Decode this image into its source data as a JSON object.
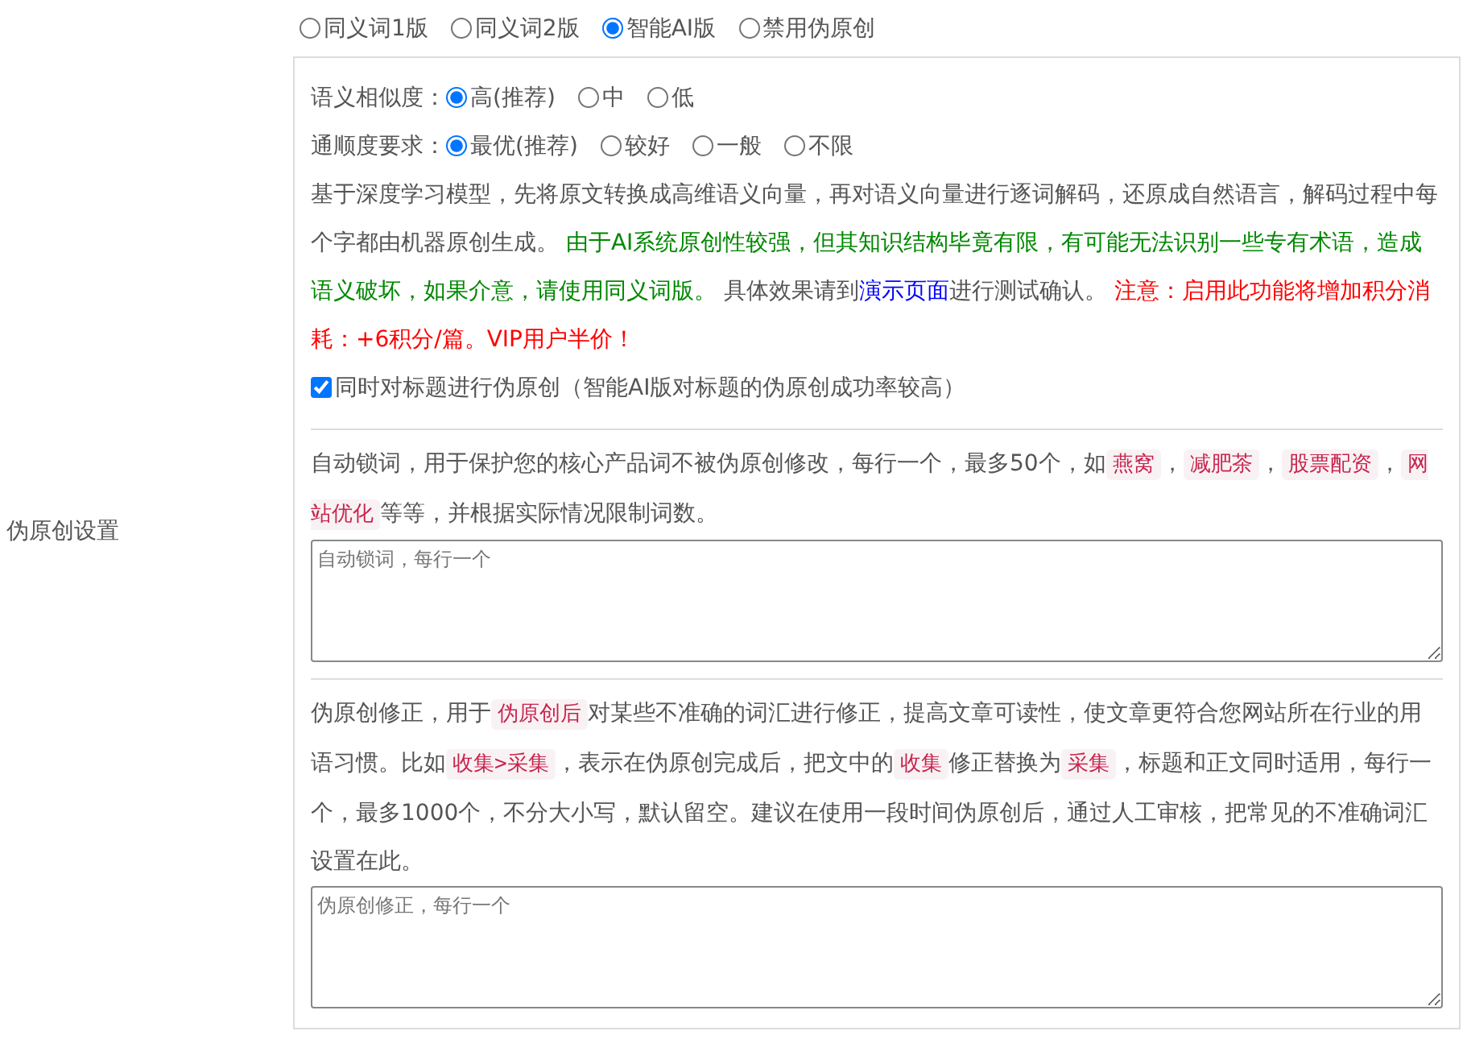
{
  "mode_options": [
    {
      "label": "同义词1版",
      "selected": false
    },
    {
      "label": "同义词2版",
      "selected": false
    },
    {
      "label": "智能AI版",
      "selected": true
    },
    {
      "label": "禁用伪原创",
      "selected": false
    }
  ],
  "settings_label": "伪原创设置",
  "ai_panel": {
    "similarity": {
      "label": "语义相似度：",
      "options": [
        {
          "label": "高(推荐)",
          "selected": true
        },
        {
          "label": "中",
          "selected": false
        },
        {
          "label": "低",
          "selected": false
        }
      ]
    },
    "fluency": {
      "label": "通顺度要求：",
      "options": [
        {
          "label": "最优(推荐)",
          "selected": true
        },
        {
          "label": "较好",
          "selected": false
        },
        {
          "label": "一般",
          "selected": false
        },
        {
          "label": "不限",
          "selected": false
        }
      ]
    },
    "description": [
      {
        "kind": "text",
        "text": "基于深度学习模型，先将原文转换成高维语义向量，再对语义向量进行逐词解码，还原成自然语言，解码过程中每个字都由机器原创生成。 "
      },
      {
        "kind": "green",
        "text": "由于AI系统原创性较强，但其知识结构毕竟有限，有可能无法识别一些专有术语，造成语义破坏，如果介意，请使用同义词版。"
      },
      {
        "kind": "text",
        "text": " 具体效果请到"
      },
      {
        "kind": "link",
        "text": "演示页面"
      },
      {
        "kind": "text",
        "text": "进行测试确认。 "
      },
      {
        "kind": "red",
        "text": "注意：启用此功能将增加积分消耗：+6积分/篇。VIP用户半价！"
      }
    ],
    "title_checkbox": {
      "label": "同时对标题进行伪原创（智能AI版对标题的伪原创成功率较高）",
      "checked": true
    }
  },
  "lock_words": {
    "description": [
      {
        "kind": "text",
        "text": "自动锁词，用于保护您的核心产品词不被伪原创修改，每行一个，最多50个，如"
      },
      {
        "kind": "code",
        "text": "燕窝"
      },
      {
        "kind": "text",
        "text": "，"
      },
      {
        "kind": "code",
        "text": "减肥茶"
      },
      {
        "kind": "text",
        "text": "，"
      },
      {
        "kind": "code",
        "text": "股票配资"
      },
      {
        "kind": "text",
        "text": "，"
      },
      {
        "kind": "code",
        "text": "网站优化"
      },
      {
        "kind": "text",
        "text": "等等，并根据实际情况限制词数。"
      }
    ],
    "placeholder": "自动锁词，每行一个"
  },
  "corrections": {
    "description": [
      {
        "kind": "text",
        "text": "伪原创修正，用于"
      },
      {
        "kind": "code",
        "text": "伪原创后"
      },
      {
        "kind": "text",
        "text": "对某些不准确的词汇进行修正，提高文章可读性，使文章更符合您网站所在行业的用语习惯。比如"
      },
      {
        "kind": "code",
        "text": "收集>采集"
      },
      {
        "kind": "text",
        "text": "，表示在伪原创完成后，把文中的"
      },
      {
        "kind": "code",
        "text": "收集"
      },
      {
        "kind": "text",
        "text": "修正替换为"
      },
      {
        "kind": "code",
        "text": "采集"
      },
      {
        "kind": "text",
        "text": "，标题和正文同时适用，每行一个，最多1000个，不分大小写，默认留空。建议在使用一段时间伪原创后，通过人工审核，把常见的不准确词汇设置在此。"
      }
    ],
    "placeholder": "伪原创修正，每行一个"
  }
}
